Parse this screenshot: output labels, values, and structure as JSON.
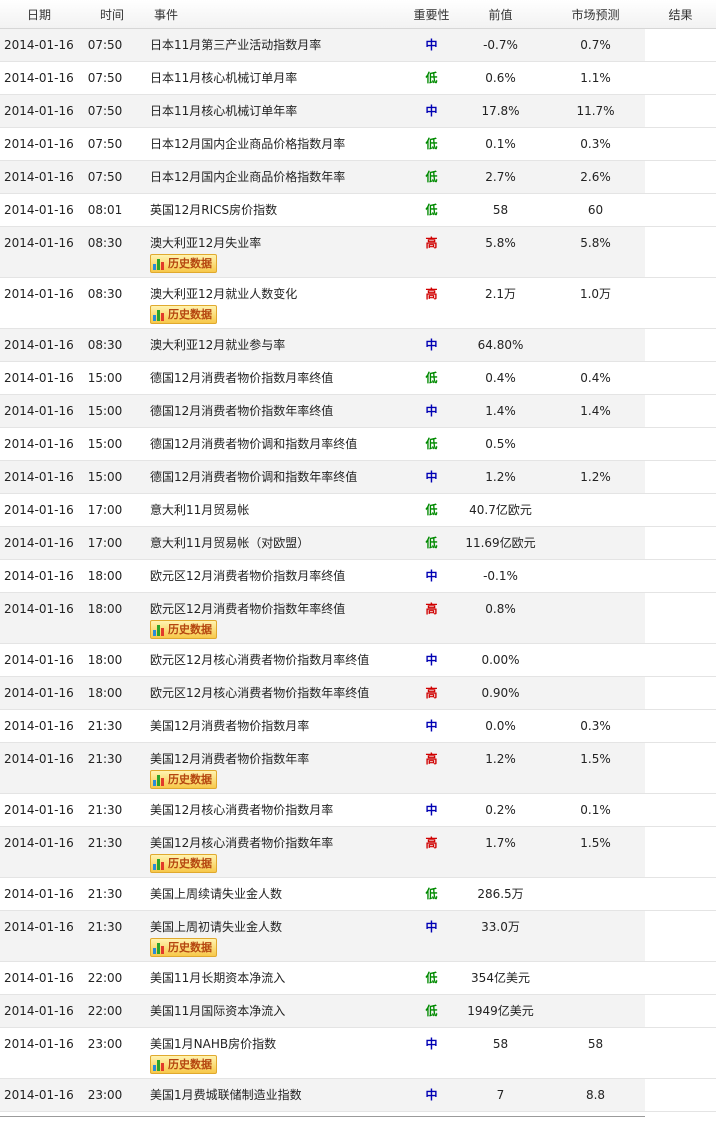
{
  "headers": {
    "date": "日期",
    "time": "时间",
    "event": "事件",
    "importance": "重要性",
    "previous": "前值",
    "forecast": "市场预测",
    "result": "结果"
  },
  "history_button_label": "历史数据",
  "colors": {
    "high": "#d00000",
    "mid": "#0000b4",
    "low": "#008a00",
    "button": "#f7c84a"
  },
  "rows": [
    {
      "date": "2014-01-16",
      "time": "07:50",
      "event": "日本11月第三产业活动指数月率",
      "importance": "中",
      "level": "mid",
      "previous": "-0.7%",
      "forecast": "0.7%",
      "result": "",
      "history": false
    },
    {
      "date": "2014-01-16",
      "time": "07:50",
      "event": "日本11月核心机械订单月率",
      "importance": "低",
      "level": "low",
      "previous": "0.6%",
      "forecast": "1.1%",
      "result": "",
      "history": false
    },
    {
      "date": "2014-01-16",
      "time": "07:50",
      "event": "日本11月核心机械订单年率",
      "importance": "中",
      "level": "mid",
      "previous": "17.8%",
      "forecast": "11.7%",
      "result": "",
      "history": false
    },
    {
      "date": "2014-01-16",
      "time": "07:50",
      "event": "日本12月国内企业商品价格指数月率",
      "importance": "低",
      "level": "low",
      "previous": "0.1%",
      "forecast": "0.3%",
      "result": "",
      "history": false
    },
    {
      "date": "2014-01-16",
      "time": "07:50",
      "event": "日本12月国内企业商品价格指数年率",
      "importance": "低",
      "level": "low",
      "previous": "2.7%",
      "forecast": "2.6%",
      "result": "",
      "history": false
    },
    {
      "date": "2014-01-16",
      "time": "08:01",
      "event": "英国12月RICS房价指数",
      "importance": "低",
      "level": "low",
      "previous": "58",
      "forecast": "60",
      "result": "",
      "history": false
    },
    {
      "date": "2014-01-16",
      "time": "08:30",
      "event": "澳大利亚12月失业率",
      "importance": "高",
      "level": "high",
      "previous": "5.8%",
      "forecast": "5.8%",
      "result": "",
      "history": true
    },
    {
      "date": "2014-01-16",
      "time": "08:30",
      "event": "澳大利亚12月就业人数变化",
      "importance": "高",
      "level": "high",
      "previous": "2.1万",
      "forecast": "1.0万",
      "result": "",
      "history": true
    },
    {
      "date": "2014-01-16",
      "time": "08:30",
      "event": "澳大利亚12月就业参与率",
      "importance": "中",
      "level": "mid",
      "previous": "64.80%",
      "forecast": "",
      "result": "",
      "history": false
    },
    {
      "date": "2014-01-16",
      "time": "15:00",
      "event": "德国12月消费者物价指数月率终值",
      "importance": "低",
      "level": "low",
      "previous": "0.4%",
      "forecast": "0.4%",
      "result": "",
      "history": false
    },
    {
      "date": "2014-01-16",
      "time": "15:00",
      "event": "德国12月消费者物价指数年率终值",
      "importance": "中",
      "level": "mid",
      "previous": "1.4%",
      "forecast": "1.4%",
      "result": "",
      "history": false
    },
    {
      "date": "2014-01-16",
      "time": "15:00",
      "event": "德国12月消费者物价调和指数月率终值",
      "importance": "低",
      "level": "low",
      "previous": "0.5%",
      "forecast": "",
      "result": "",
      "history": false
    },
    {
      "date": "2014-01-16",
      "time": "15:00",
      "event": "德国12月消费者物价调和指数年率终值",
      "importance": "中",
      "level": "mid",
      "previous": "1.2%",
      "forecast": "1.2%",
      "result": "",
      "history": false
    },
    {
      "date": "2014-01-16",
      "time": "17:00",
      "event": "意大利11月贸易帐",
      "importance": "低",
      "level": "low",
      "previous": "40.7亿欧元",
      "forecast": "",
      "result": "",
      "history": false
    },
    {
      "date": "2014-01-16",
      "time": "17:00",
      "event": "意大利11月贸易帐（对欧盟）",
      "importance": "低",
      "level": "low",
      "previous": "11.69亿欧元",
      "forecast": "",
      "result": "",
      "history": false
    },
    {
      "date": "2014-01-16",
      "time": "18:00",
      "event": "欧元区12月消费者物价指数月率终值",
      "importance": "中",
      "level": "mid",
      "previous": "-0.1%",
      "forecast": "",
      "result": "",
      "history": false
    },
    {
      "date": "2014-01-16",
      "time": "18:00",
      "event": "欧元区12月消费者物价指数年率终值",
      "importance": "高",
      "level": "high",
      "previous": "0.8%",
      "forecast": "",
      "result": "",
      "history": true
    },
    {
      "date": "2014-01-16",
      "time": "18:00",
      "event": "欧元区12月核心消费者物价指数月率终值",
      "importance": "中",
      "level": "mid",
      "previous": "0.00%",
      "forecast": "",
      "result": "",
      "history": false
    },
    {
      "date": "2014-01-16",
      "time": "18:00",
      "event": "欧元区12月核心消费者物价指数年率终值",
      "importance": "高",
      "level": "high",
      "previous": "0.90%",
      "forecast": "",
      "result": "",
      "history": false
    },
    {
      "date": "2014-01-16",
      "time": "21:30",
      "event": "美国12月消费者物价指数月率",
      "importance": "中",
      "level": "mid",
      "previous": "0.0%",
      "forecast": "0.3%",
      "result": "",
      "history": false
    },
    {
      "date": "2014-01-16",
      "time": "21:30",
      "event": "美国12月消费者物价指数年率",
      "importance": "高",
      "level": "high",
      "previous": "1.2%",
      "forecast": "1.5%",
      "result": "",
      "history": true
    },
    {
      "date": "2014-01-16",
      "time": "21:30",
      "event": "美国12月核心消费者物价指数月率",
      "importance": "中",
      "level": "mid",
      "previous": "0.2%",
      "forecast": "0.1%",
      "result": "",
      "history": false
    },
    {
      "date": "2014-01-16",
      "time": "21:30",
      "event": "美国12月核心消费者物价指数年率",
      "importance": "高",
      "level": "high",
      "previous": "1.7%",
      "forecast": "1.5%",
      "result": "",
      "history": true
    },
    {
      "date": "2014-01-16",
      "time": "21:30",
      "event": "美国上周续请失业金人数",
      "importance": "低",
      "level": "low",
      "previous": "286.5万",
      "forecast": "",
      "result": "",
      "history": false
    },
    {
      "date": "2014-01-16",
      "time": "21:30",
      "event": "美国上周初请失业金人数",
      "importance": "中",
      "level": "mid",
      "previous": "33.0万",
      "forecast": "",
      "result": "",
      "history": true
    },
    {
      "date": "2014-01-16",
      "time": "22:00",
      "event": "美国11月长期资本净流入",
      "importance": "低",
      "level": "low",
      "previous": "354亿美元",
      "forecast": "",
      "result": "",
      "history": false
    },
    {
      "date": "2014-01-16",
      "time": "22:00",
      "event": "美国11月国际资本净流入",
      "importance": "低",
      "level": "low",
      "previous": "1949亿美元",
      "forecast": "",
      "result": "",
      "history": false
    },
    {
      "date": "2014-01-16",
      "time": "23:00",
      "event": "美国1月NAHB房价指数",
      "importance": "中",
      "level": "mid",
      "previous": "58",
      "forecast": "58",
      "result": "",
      "history": true
    },
    {
      "date": "2014-01-16",
      "time": "23:00",
      "event": "美国1月费城联储制造业指数",
      "importance": "中",
      "level": "mid",
      "previous": "7",
      "forecast": "8.8",
      "result": "",
      "history": false
    }
  ]
}
